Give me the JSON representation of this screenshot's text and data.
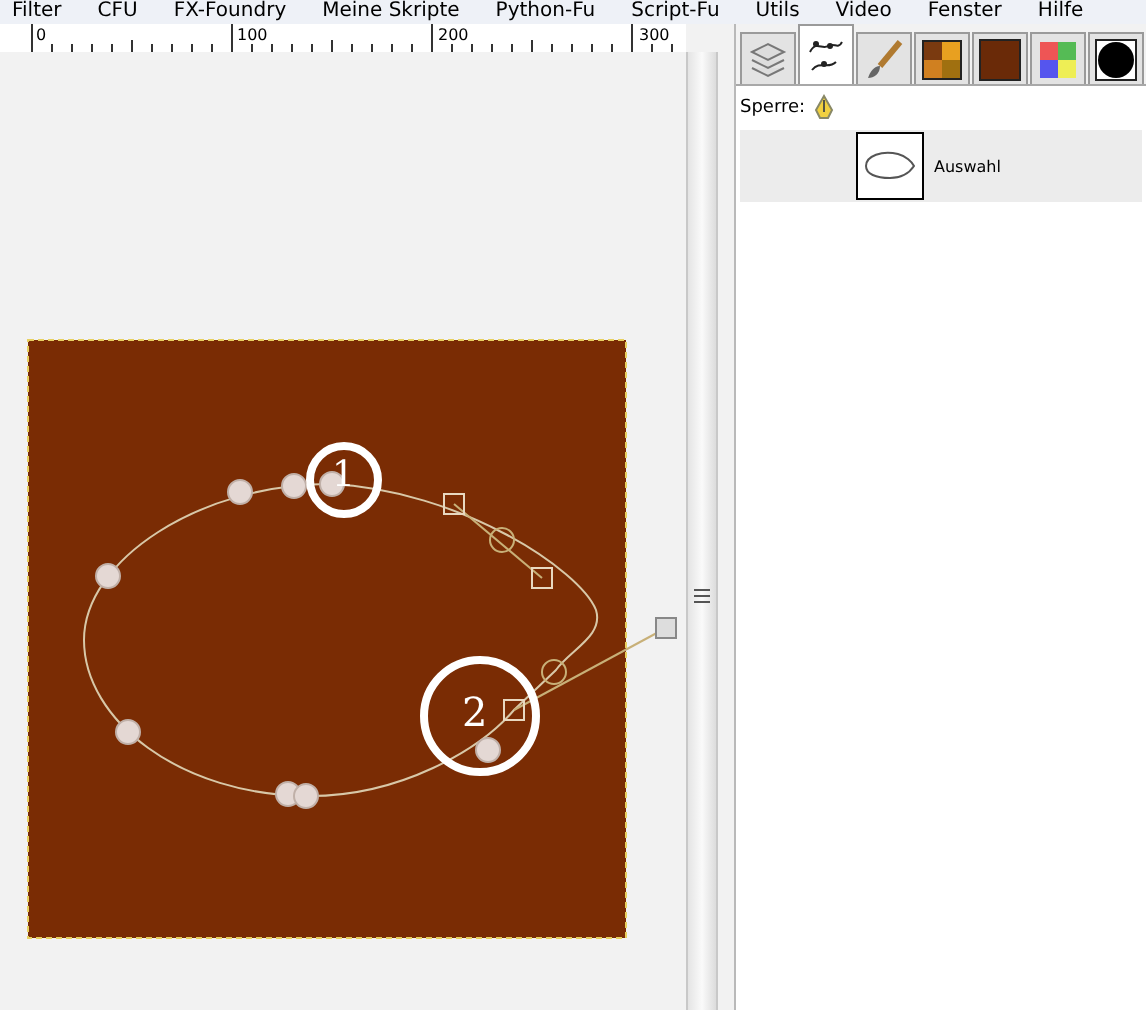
{
  "menu": [
    "Filter",
    "CFU",
    "FX-Foundry",
    "Meine Skripte",
    "Python-Fu",
    "Script-Fu",
    "Utils",
    "Video",
    "Fenster",
    "Hilfe"
  ],
  "ruler": {
    "labels": [
      "0",
      "100",
      "200",
      "300"
    ]
  },
  "canvas": {
    "annotations": [
      "1",
      "2"
    ]
  },
  "dock": {
    "tabs": [
      {
        "kind": "layers",
        "selected": false
      },
      {
        "kind": "paths",
        "selected": true
      },
      {
        "kind": "brush",
        "selected": false
      },
      {
        "kind": "palette",
        "selected": false
      },
      {
        "kind": "color",
        "selected": false
      },
      {
        "kind": "pattern",
        "selected": false
      },
      {
        "kind": "circle",
        "selected": false
      }
    ],
    "lock_label": "Sperre:",
    "paths": [
      {
        "name": "Auswahl",
        "selected": true
      }
    ]
  }
}
